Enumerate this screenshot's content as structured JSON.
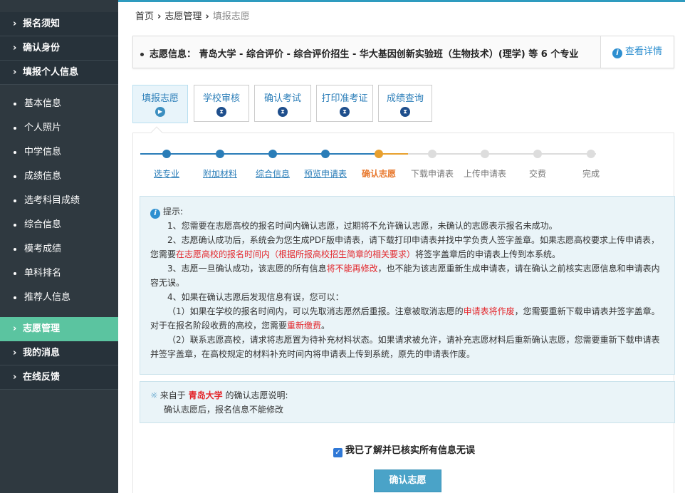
{
  "sidebar": {
    "top_items": [
      {
        "label": "报名须知"
      },
      {
        "label": "确认身份"
      },
      {
        "label": "填报个人信息"
      }
    ],
    "sub_items": [
      {
        "label": "基本信息"
      },
      {
        "label": "个人照片"
      },
      {
        "label": "中学信息"
      },
      {
        "label": "成绩信息"
      },
      {
        "label": "选考科目成绩"
      },
      {
        "label": "综合信息"
      },
      {
        "label": "模考成绩"
      },
      {
        "label": "单科排名"
      },
      {
        "label": "推荐人信息"
      }
    ],
    "bottom_items": [
      {
        "label": "志愿管理",
        "active": true
      },
      {
        "label": "我的消息"
      },
      {
        "label": "在线反馈"
      }
    ]
  },
  "breadcrumb": {
    "home": "首页",
    "parent": "志愿管理",
    "current": "填报志愿"
  },
  "infobar": {
    "text": "志愿信息：  青岛大学 - 综合评价 - 综合评价招生 - 华大基因创新实验班（生物技术）(理学) 等 6 个专业",
    "detail_label": "查看详情"
  },
  "tabs": [
    {
      "label": "填报志愿",
      "active": true
    },
    {
      "label": "学校审核"
    },
    {
      "label": "确认考试"
    },
    {
      "label": "打印准考证"
    },
    {
      "label": "成绩查询"
    }
  ],
  "steps": [
    {
      "label": "选专业",
      "state": "done"
    },
    {
      "label": "附加材料",
      "state": "done"
    },
    {
      "label": "综合信息",
      "state": "done"
    },
    {
      "label": "预览申请表",
      "state": "done"
    },
    {
      "label": "确认志愿",
      "state": "current"
    },
    {
      "label": "下载申请表",
      "state": "todo"
    },
    {
      "label": "上传申请表",
      "state": "todo"
    },
    {
      "label": "交费",
      "state": "todo"
    },
    {
      "label": "完成",
      "state": "todo"
    }
  ],
  "tip": {
    "title": "提示:",
    "p1": "1、您需要在志愿高校的报名时间内确认志愿，过期将不允许确认志愿，未确认的志愿表示报名未成功。",
    "p2a": "2、志愿确认成功后，系统会为您生成PDF版申请表，请下载打印申请表并找中学负责人签字盖章。如果志愿高校要求上传申请表，您需要",
    "p2b": "在志愿高校的报名时间内（根据所报高校招生简章的相关要求）",
    "p2c": "将签字盖章后的申请表上传到本系统。",
    "p3a": "3、志愿一旦确认成功，该志愿的所有信息",
    "p3b": "将不能再修改",
    "p3c": "，也不能为该志愿重新生成申请表，请在确认之前核实志愿信息和申请表内容无误。",
    "p4": "4、如果在确认志愿后发现信息有误，您可以：",
    "p5a": "（1）如果在学校的报名时间内，可以先取消志愿然后重报。注意被取消志愿的",
    "p5b": "申请表将作废",
    "p5c": "，您需要重新下载申请表并签字盖章。对于在报名阶段收费的高校，您需要",
    "p5d": "重新缴费",
    "p5e": "。",
    "p6": "（2）联系志愿高校，请求将志愿置为待补充材料状态。如果请求被允许，请补充志愿材料后重新确认志愿，您需要重新下载申请表并签字盖章，在高校规定的材料补充时间内将申请表上传到系统，原先的申请表作废。"
  },
  "note": {
    "prefix": "来自于",
    "school": "青岛大学",
    "suffix": "的确认志愿说明:",
    "body": "确认志愿后，报名信息不能修改"
  },
  "agree_label": "我已了解并已核实所有信息无误",
  "confirm_label": "确认志愿",
  "colors": {
    "accent": "#2e9bbf",
    "sidebar_bg": "#2f3940",
    "sidebar_active": "#5bc4a0",
    "step_done": "#2a7db8",
    "step_current": "#e8a02e",
    "step_todo": "#dddddd",
    "warning_red": "#e3262b"
  }
}
